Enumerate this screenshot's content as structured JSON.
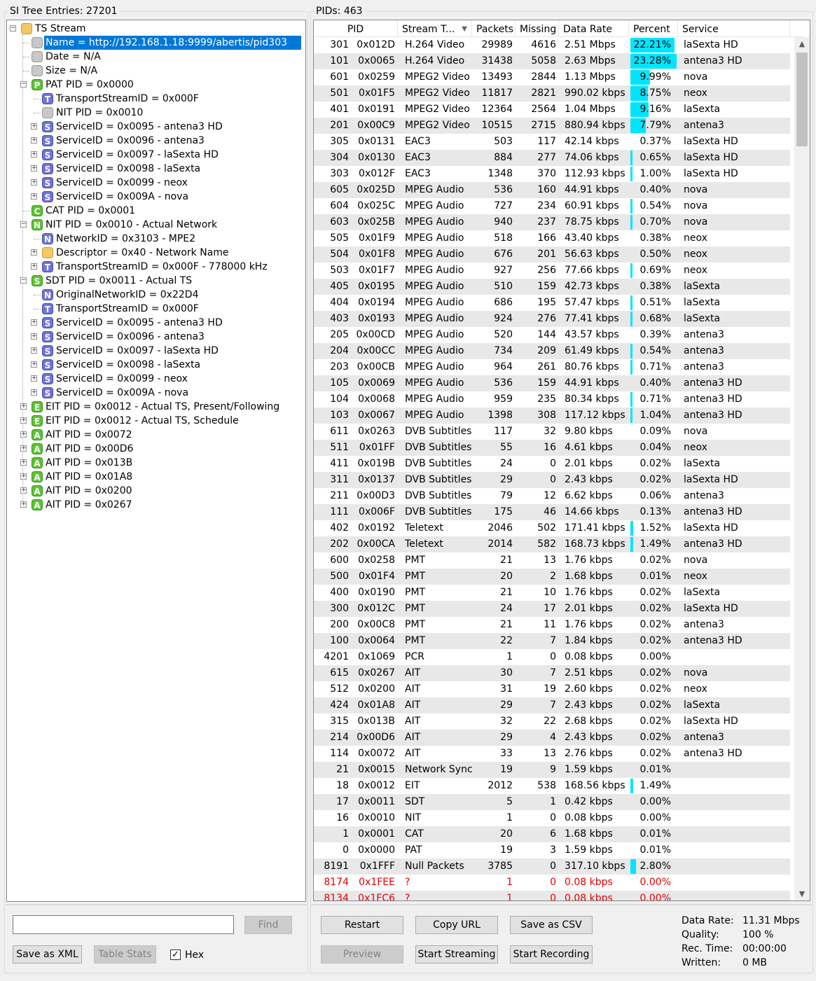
{
  "left_panel": {
    "title": "SI Tree Entries: 27201",
    "tree": [
      {
        "level": 0,
        "exp": "-",
        "icon": "folder",
        "letter": "",
        "label": "TS Stream"
      },
      {
        "level": 1,
        "exp": "",
        "icon": "gray",
        "letter": "",
        "label": "Name = http://192.168.1.18:9999/abertis/pid303",
        "selected": true
      },
      {
        "level": 1,
        "exp": "",
        "icon": "gray",
        "letter": "",
        "label": "Date = N/A"
      },
      {
        "level": 1,
        "exp": "",
        "icon": "gray",
        "letter": "",
        "label": "Size = N/A"
      },
      {
        "level": 1,
        "exp": "-",
        "icon": "green",
        "letter": "P",
        "label": "PAT PID = 0x0000"
      },
      {
        "level": 2,
        "exp": "",
        "icon": "blue",
        "letter": "T",
        "label": "TransportStreamID = 0x000F"
      },
      {
        "level": 2,
        "exp": "",
        "icon": "gray",
        "letter": "",
        "label": "NIT PID = 0x0010"
      },
      {
        "level": 2,
        "exp": "+",
        "icon": "blue",
        "letter": "S",
        "label": "ServiceID = 0x0095 - antena3 HD"
      },
      {
        "level": 2,
        "exp": "+",
        "icon": "blue",
        "letter": "S",
        "label": "ServiceID = 0x0096 - antena3"
      },
      {
        "level": 2,
        "exp": "+",
        "icon": "blue",
        "letter": "S",
        "label": "ServiceID = 0x0097 - laSexta HD"
      },
      {
        "level": 2,
        "exp": "+",
        "icon": "blue",
        "letter": "S",
        "label": "ServiceID = 0x0098 - laSexta"
      },
      {
        "level": 2,
        "exp": "+",
        "icon": "blue",
        "letter": "S",
        "label": "ServiceID = 0x0099 - neox"
      },
      {
        "level": 2,
        "exp": "+",
        "icon": "blue",
        "letter": "S",
        "label": "ServiceID = 0x009A - nova"
      },
      {
        "level": 1,
        "exp": "",
        "icon": "green",
        "letter": "C",
        "label": "CAT PID = 0x0001"
      },
      {
        "level": 1,
        "exp": "-",
        "icon": "green",
        "letter": "N",
        "label": "NIT PID = 0x0010 - Actual Network"
      },
      {
        "level": 2,
        "exp": "",
        "icon": "blue",
        "letter": "N",
        "label": "NetworkID = 0x3103 - MPE2"
      },
      {
        "level": 2,
        "exp": "+",
        "icon": "orange",
        "letter": "",
        "label": "Descriptor = 0x40 - Network Name"
      },
      {
        "level": 2,
        "exp": "+",
        "icon": "blue",
        "letter": "T",
        "label": "TransportStreamID = 0x000F - 778000 kHz"
      },
      {
        "level": 1,
        "exp": "-",
        "icon": "green",
        "letter": "S",
        "label": "SDT PID = 0x0011 - Actual TS"
      },
      {
        "level": 2,
        "exp": "",
        "icon": "blue",
        "letter": "N",
        "label": "OriginalNetworkID = 0x22D4"
      },
      {
        "level": 2,
        "exp": "",
        "icon": "blue",
        "letter": "T",
        "label": "TransportStreamID = 0x000F"
      },
      {
        "level": 2,
        "exp": "+",
        "icon": "blue",
        "letter": "S",
        "label": "ServiceID = 0x0095 - antena3 HD"
      },
      {
        "level": 2,
        "exp": "+",
        "icon": "blue",
        "letter": "S",
        "label": "ServiceID = 0x0096 - antena3"
      },
      {
        "level": 2,
        "exp": "+",
        "icon": "blue",
        "letter": "S",
        "label": "ServiceID = 0x0097 - laSexta HD"
      },
      {
        "level": 2,
        "exp": "+",
        "icon": "blue",
        "letter": "S",
        "label": "ServiceID = 0x0098 - laSexta"
      },
      {
        "level": 2,
        "exp": "+",
        "icon": "blue",
        "letter": "S",
        "label": "ServiceID = 0x0099 - neox"
      },
      {
        "level": 2,
        "exp": "+",
        "icon": "blue",
        "letter": "S",
        "label": "ServiceID = 0x009A - nova"
      },
      {
        "level": 1,
        "exp": "+",
        "icon": "green",
        "letter": "E",
        "label": "EIT PID = 0x0012 - Actual TS, Present/Following"
      },
      {
        "level": 1,
        "exp": "+",
        "icon": "green",
        "letter": "E",
        "label": "EIT PID = 0x0012 - Actual TS, Schedule"
      },
      {
        "level": 1,
        "exp": "+",
        "icon": "green",
        "letter": "A",
        "label": "AIT PID = 0x0072"
      },
      {
        "level": 1,
        "exp": "+",
        "icon": "green",
        "letter": "A",
        "label": "AIT PID = 0x00D6"
      },
      {
        "level": 1,
        "exp": "+",
        "icon": "green",
        "letter": "A",
        "label": "AIT PID = 0x013B"
      },
      {
        "level": 1,
        "exp": "+",
        "icon": "green",
        "letter": "A",
        "label": "AIT PID = 0x01A8"
      },
      {
        "level": 1,
        "exp": "+",
        "icon": "green",
        "letter": "A",
        "label": "AIT PID = 0x0200"
      },
      {
        "level": 1,
        "exp": "+",
        "icon": "green",
        "letter": "A",
        "label": "AIT PID = 0x0267"
      }
    ],
    "find_input_value": "",
    "find_button": "Find",
    "save_xml_button": "Save as XML",
    "table_stats_button": "Table Stats",
    "hex_label": "Hex",
    "hex_checked": true
  },
  "right_panel": {
    "title": "PIDs: 463",
    "columns": [
      "PID",
      "Stream T...",
      "Packets",
      "Missing",
      "Data Rate",
      "Percent",
      "Service"
    ],
    "rows": [
      {
        "pid": "301",
        "hex": "0x012D",
        "type": "H.264 Video",
        "packets": "29989",
        "missing": "4616",
        "rate": "2.51 Mbps",
        "percent": "22.21%",
        "pct": 22.21,
        "service": "laSexta HD"
      },
      {
        "pid": "101",
        "hex": "0x0065",
        "type": "H.264 Video",
        "packets": "31438",
        "missing": "5058",
        "rate": "2.63 Mbps",
        "percent": "23.28%",
        "pct": 23.28,
        "service": "antena3 HD"
      },
      {
        "pid": "601",
        "hex": "0x0259",
        "type": "MPEG2 Video",
        "packets": "13493",
        "missing": "2844",
        "rate": "1.13 Mbps",
        "percent": "9.99%",
        "pct": 9.99,
        "service": "nova"
      },
      {
        "pid": "501",
        "hex": "0x01F5",
        "type": "MPEG2 Video",
        "packets": "11817",
        "missing": "2821",
        "rate": "990.02 kbps",
        "percent": "8.75%",
        "pct": 8.75,
        "service": "neox"
      },
      {
        "pid": "401",
        "hex": "0x0191",
        "type": "MPEG2 Video",
        "packets": "12364",
        "missing": "2564",
        "rate": "1.04 Mbps",
        "percent": "9.16%",
        "pct": 9.16,
        "service": "laSexta"
      },
      {
        "pid": "201",
        "hex": "0x00C9",
        "type": "MPEG2 Video",
        "packets": "10515",
        "missing": "2715",
        "rate": "880.94 kbps",
        "percent": "7.79%",
        "pct": 7.79,
        "service": "antena3"
      },
      {
        "pid": "305",
        "hex": "0x0131",
        "type": "EAC3",
        "packets": "503",
        "missing": "117",
        "rate": "42.14 kbps",
        "percent": "0.37%",
        "pct": 0.37,
        "service": "laSexta HD"
      },
      {
        "pid": "304",
        "hex": "0x0130",
        "type": "EAC3",
        "packets": "884",
        "missing": "277",
        "rate": "74.06 kbps",
        "percent": "0.65%",
        "pct": 0.65,
        "service": "laSexta HD"
      },
      {
        "pid": "303",
        "hex": "0x012F",
        "type": "EAC3",
        "packets": "1348",
        "missing": "370",
        "rate": "112.93 kbps",
        "percent": "1.00%",
        "pct": 1.0,
        "service": "laSexta HD"
      },
      {
        "pid": "605",
        "hex": "0x025D",
        "type": "MPEG Audio",
        "packets": "536",
        "missing": "160",
        "rate": "44.91 kbps",
        "percent": "0.40%",
        "pct": 0.4,
        "service": "nova"
      },
      {
        "pid": "604",
        "hex": "0x025C",
        "type": "MPEG Audio",
        "packets": "727",
        "missing": "234",
        "rate": "60.91 kbps",
        "percent": "0.54%",
        "pct": 0.54,
        "service": "nova"
      },
      {
        "pid": "603",
        "hex": "0x025B",
        "type": "MPEG Audio",
        "packets": "940",
        "missing": "237",
        "rate": "78.75 kbps",
        "percent": "0.70%",
        "pct": 0.7,
        "service": "nova"
      },
      {
        "pid": "505",
        "hex": "0x01F9",
        "type": "MPEG Audio",
        "packets": "518",
        "missing": "166",
        "rate": "43.40 kbps",
        "percent": "0.38%",
        "pct": 0.38,
        "service": "neox"
      },
      {
        "pid": "504",
        "hex": "0x01F8",
        "type": "MPEG Audio",
        "packets": "676",
        "missing": "201",
        "rate": "56.63 kbps",
        "percent": "0.50%",
        "pct": 0.5,
        "service": "neox"
      },
      {
        "pid": "503",
        "hex": "0x01F7",
        "type": "MPEG Audio",
        "packets": "927",
        "missing": "256",
        "rate": "77.66 kbps",
        "percent": "0.69%",
        "pct": 0.69,
        "service": "neox"
      },
      {
        "pid": "405",
        "hex": "0x0195",
        "type": "MPEG Audio",
        "packets": "510",
        "missing": "159",
        "rate": "42.73 kbps",
        "percent": "0.38%",
        "pct": 0.38,
        "service": "laSexta"
      },
      {
        "pid": "404",
        "hex": "0x0194",
        "type": "MPEG Audio",
        "packets": "686",
        "missing": "195",
        "rate": "57.47 kbps",
        "percent": "0.51%",
        "pct": 0.51,
        "service": "laSexta"
      },
      {
        "pid": "403",
        "hex": "0x0193",
        "type": "MPEG Audio",
        "packets": "924",
        "missing": "276",
        "rate": "77.41 kbps",
        "percent": "0.68%",
        "pct": 0.68,
        "service": "laSexta"
      },
      {
        "pid": "205",
        "hex": "0x00CD",
        "type": "MPEG Audio",
        "packets": "520",
        "missing": "144",
        "rate": "43.57 kbps",
        "percent": "0.39%",
        "pct": 0.39,
        "service": "antena3"
      },
      {
        "pid": "204",
        "hex": "0x00CC",
        "type": "MPEG Audio",
        "packets": "734",
        "missing": "209",
        "rate": "61.49 kbps",
        "percent": "0.54%",
        "pct": 0.54,
        "service": "antena3"
      },
      {
        "pid": "203",
        "hex": "0x00CB",
        "type": "MPEG Audio",
        "packets": "964",
        "missing": "261",
        "rate": "80.76 kbps",
        "percent": "0.71%",
        "pct": 0.71,
        "service": "antena3"
      },
      {
        "pid": "105",
        "hex": "0x0069",
        "type": "MPEG Audio",
        "packets": "536",
        "missing": "159",
        "rate": "44.91 kbps",
        "percent": "0.40%",
        "pct": 0.4,
        "service": "antena3 HD"
      },
      {
        "pid": "104",
        "hex": "0x0068",
        "type": "MPEG Audio",
        "packets": "959",
        "missing": "235",
        "rate": "80.34 kbps",
        "percent": "0.71%",
        "pct": 0.71,
        "service": "antena3 HD"
      },
      {
        "pid": "103",
        "hex": "0x0067",
        "type": "MPEG Audio",
        "packets": "1398",
        "missing": "308",
        "rate": "117.12 kbps",
        "percent": "1.04%",
        "pct": 1.04,
        "service": "antena3 HD"
      },
      {
        "pid": "611",
        "hex": "0x0263",
        "type": "DVB Subtitles",
        "packets": "117",
        "missing": "32",
        "rate": "9.80 kbps",
        "percent": "0.09%",
        "pct": 0.09,
        "service": "nova"
      },
      {
        "pid": "511",
        "hex": "0x01FF",
        "type": "DVB Subtitles",
        "packets": "55",
        "missing": "16",
        "rate": "4.61 kbps",
        "percent": "0.04%",
        "pct": 0.04,
        "service": "neox"
      },
      {
        "pid": "411",
        "hex": "0x019B",
        "type": "DVB Subtitles",
        "packets": "24",
        "missing": "0",
        "rate": "2.01 kbps",
        "percent": "0.02%",
        "pct": 0.02,
        "service": "laSexta"
      },
      {
        "pid": "311",
        "hex": "0x0137",
        "type": "DVB Subtitles",
        "packets": "29",
        "missing": "0",
        "rate": "2.43 kbps",
        "percent": "0.02%",
        "pct": 0.02,
        "service": "laSexta HD"
      },
      {
        "pid": "211",
        "hex": "0x00D3",
        "type": "DVB Subtitles",
        "packets": "79",
        "missing": "12",
        "rate": "6.62 kbps",
        "percent": "0.06%",
        "pct": 0.06,
        "service": "antena3"
      },
      {
        "pid": "111",
        "hex": "0x006F",
        "type": "DVB Subtitles",
        "packets": "175",
        "missing": "46",
        "rate": "14.66 kbps",
        "percent": "0.13%",
        "pct": 0.13,
        "service": "antena3 HD"
      },
      {
        "pid": "402",
        "hex": "0x0192",
        "type": "Teletext",
        "packets": "2046",
        "missing": "502",
        "rate": "171.41 kbps",
        "percent": "1.52%",
        "pct": 1.52,
        "service": "laSexta HD"
      },
      {
        "pid": "202",
        "hex": "0x00CA",
        "type": "Teletext",
        "packets": "2014",
        "missing": "582",
        "rate": "168.73 kbps",
        "percent": "1.49%",
        "pct": 1.49,
        "service": "antena3 HD"
      },
      {
        "pid": "600",
        "hex": "0x0258",
        "type": "PMT",
        "packets": "21",
        "missing": "13",
        "rate": "1.76 kbps",
        "percent": "0.02%",
        "pct": 0.02,
        "service": "nova"
      },
      {
        "pid": "500",
        "hex": "0x01F4",
        "type": "PMT",
        "packets": "20",
        "missing": "2",
        "rate": "1.68 kbps",
        "percent": "0.01%",
        "pct": 0.01,
        "service": "neox"
      },
      {
        "pid": "400",
        "hex": "0x0190",
        "type": "PMT",
        "packets": "21",
        "missing": "10",
        "rate": "1.76 kbps",
        "percent": "0.02%",
        "pct": 0.02,
        "service": "laSexta"
      },
      {
        "pid": "300",
        "hex": "0x012C",
        "type": "PMT",
        "packets": "24",
        "missing": "17",
        "rate": "2.01 kbps",
        "percent": "0.02%",
        "pct": 0.02,
        "service": "laSexta HD"
      },
      {
        "pid": "200",
        "hex": "0x00C8",
        "type": "PMT",
        "packets": "21",
        "missing": "11",
        "rate": "1.76 kbps",
        "percent": "0.02%",
        "pct": 0.02,
        "service": "antena3"
      },
      {
        "pid": "100",
        "hex": "0x0064",
        "type": "PMT",
        "packets": "22",
        "missing": "7",
        "rate": "1.84 kbps",
        "percent": "0.02%",
        "pct": 0.02,
        "service": "antena3 HD"
      },
      {
        "pid": "4201",
        "hex": "0x1069",
        "type": "PCR",
        "packets": "1",
        "missing": "0",
        "rate": "0.08 kbps",
        "percent": "0.00%",
        "pct": 0.0,
        "service": ""
      },
      {
        "pid": "615",
        "hex": "0x0267",
        "type": "AIT",
        "packets": "30",
        "missing": "7",
        "rate": "2.51 kbps",
        "percent": "0.02%",
        "pct": 0.02,
        "service": "nova"
      },
      {
        "pid": "512",
        "hex": "0x0200",
        "type": "AIT",
        "packets": "31",
        "missing": "19",
        "rate": "2.60 kbps",
        "percent": "0.02%",
        "pct": 0.02,
        "service": "neox"
      },
      {
        "pid": "424",
        "hex": "0x01A8",
        "type": "AIT",
        "packets": "29",
        "missing": "7",
        "rate": "2.43 kbps",
        "percent": "0.02%",
        "pct": 0.02,
        "service": "laSexta"
      },
      {
        "pid": "315",
        "hex": "0x013B",
        "type": "AIT",
        "packets": "32",
        "missing": "22",
        "rate": "2.68 kbps",
        "percent": "0.02%",
        "pct": 0.02,
        "service": "laSexta HD"
      },
      {
        "pid": "214",
        "hex": "0x00D6",
        "type": "AIT",
        "packets": "29",
        "missing": "4",
        "rate": "2.43 kbps",
        "percent": "0.02%",
        "pct": 0.02,
        "service": "antena3"
      },
      {
        "pid": "114",
        "hex": "0x0072",
        "type": "AIT",
        "packets": "33",
        "missing": "13",
        "rate": "2.76 kbps",
        "percent": "0.02%",
        "pct": 0.02,
        "service": "antena3 HD"
      },
      {
        "pid": "21",
        "hex": "0x0015",
        "type": "Network Sync",
        "packets": "19",
        "missing": "9",
        "rate": "1.59 kbps",
        "percent": "0.01%",
        "pct": 0.01,
        "service": ""
      },
      {
        "pid": "18",
        "hex": "0x0012",
        "type": "EIT",
        "packets": "2012",
        "missing": "538",
        "rate": "168.56 kbps",
        "percent": "1.49%",
        "pct": 1.49,
        "service": ""
      },
      {
        "pid": "17",
        "hex": "0x0011",
        "type": "SDT",
        "packets": "5",
        "missing": "1",
        "rate": "0.42 kbps",
        "percent": "0.00%",
        "pct": 0.0,
        "service": ""
      },
      {
        "pid": "16",
        "hex": "0x0010",
        "type": "NIT",
        "packets": "1",
        "missing": "0",
        "rate": "0.08 kbps",
        "percent": "0.00%",
        "pct": 0.0,
        "service": ""
      },
      {
        "pid": "1",
        "hex": "0x0001",
        "type": "CAT",
        "packets": "20",
        "missing": "6",
        "rate": "1.68 kbps",
        "percent": "0.01%",
        "pct": 0.01,
        "service": ""
      },
      {
        "pid": "0",
        "hex": "0x0000",
        "type": "PAT",
        "packets": "19",
        "missing": "3",
        "rate": "1.59 kbps",
        "percent": "0.01%",
        "pct": 0.01,
        "service": ""
      },
      {
        "pid": "8191",
        "hex": "0x1FFF",
        "type": "Null Packets",
        "packets": "3785",
        "missing": "0",
        "rate": "317.10 kbps",
        "percent": "2.80%",
        "pct": 2.8,
        "service": ""
      },
      {
        "pid": "8174",
        "hex": "0x1FEE",
        "type": "?",
        "packets": "1",
        "missing": "0",
        "rate": "0.08 kbps",
        "percent": "0.00%",
        "pct": 0.0,
        "service": "",
        "red": true
      },
      {
        "pid": "8134",
        "hex": "0x1FC6",
        "type": "?",
        "packets": "1",
        "missing": "0",
        "rate": "0.08 kbps",
        "percent": "0.00%",
        "pct": 0.0,
        "service": "",
        "red": true
      }
    ],
    "buttons": {
      "restart": "Restart",
      "copy_url": "Copy URL",
      "save_csv": "Save as CSV",
      "preview": "Preview",
      "start_streaming": "Start Streaming",
      "start_recording": "Start Recording"
    },
    "stats": [
      {
        "label": "Data Rate:",
        "value": "11.31 Mbps"
      },
      {
        "label": "Quality:",
        "value": "100 %"
      },
      {
        "label": "Rec. Time:",
        "value": "00:00:00"
      },
      {
        "label": "Written:",
        "value": "0 MB"
      }
    ],
    "colors": {
      "percent_bar": "#00e5ff",
      "error_text": "#e00000",
      "selection": "#0078d7",
      "alt_row": "#e8e8e8"
    }
  }
}
